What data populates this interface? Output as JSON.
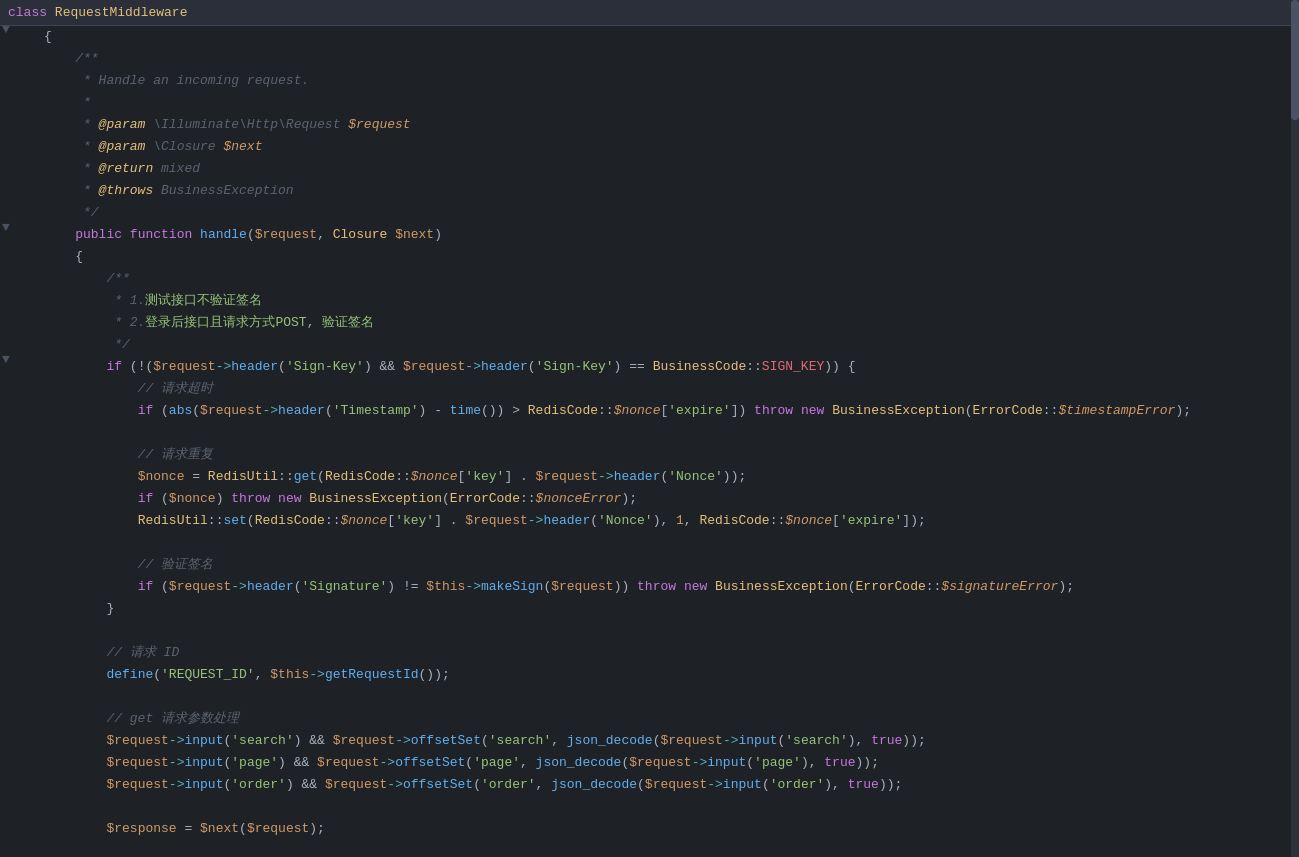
{
  "header": {
    "keyword": "class",
    "classname": "RequestMiddleware"
  },
  "colors": {
    "bg": "#1e2227",
    "gutter": "#4b5263",
    "comment": "#5c6370",
    "keyword_purple": "#c678dd",
    "keyword_blue": "#61afef",
    "variable_orange": "#d19a66",
    "string_green": "#98c379",
    "operator_teal": "#56b6c2",
    "class_yellow": "#e5c07b",
    "property_red": "#e06c75"
  }
}
